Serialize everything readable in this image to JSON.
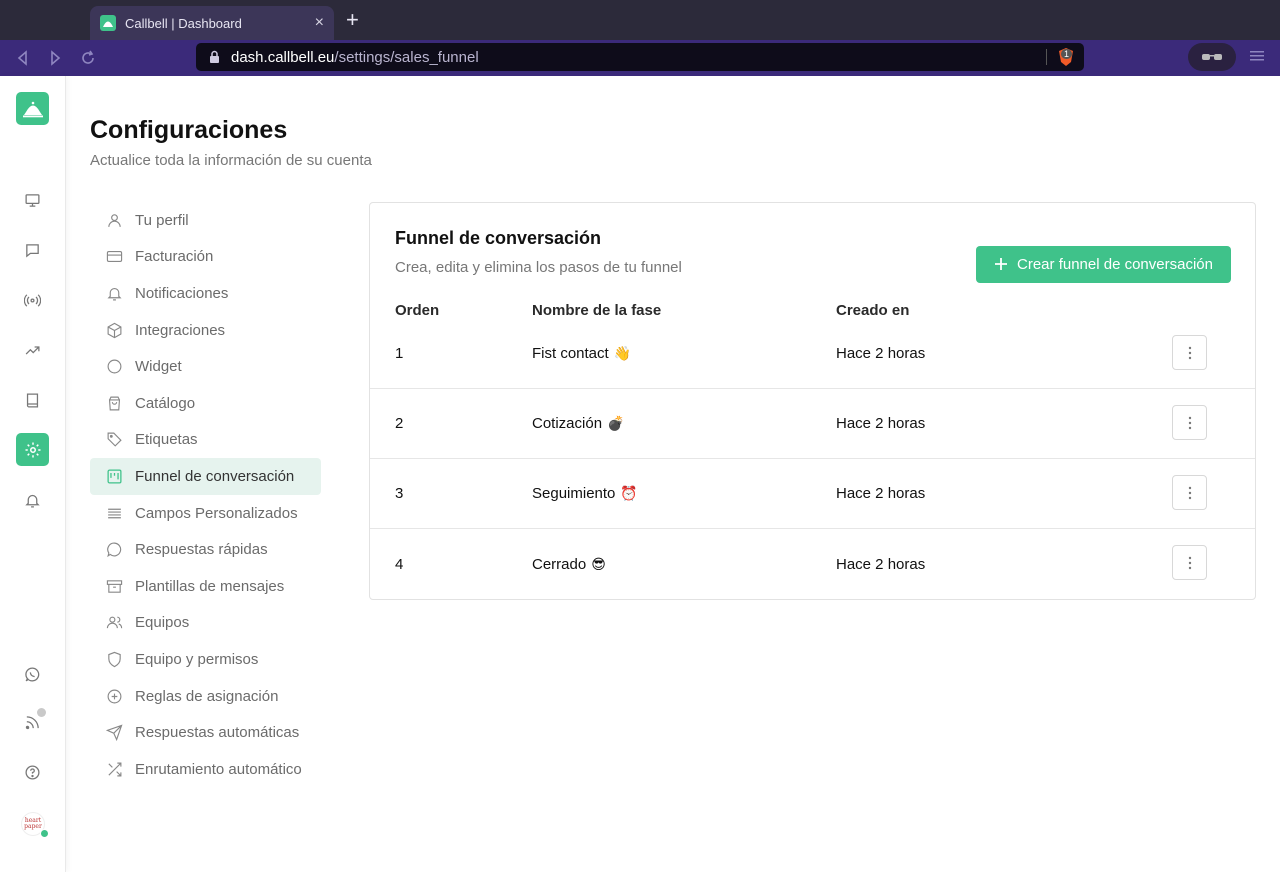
{
  "browser": {
    "tab_title": "Callbell | Dashboard",
    "tab_close": "×",
    "new_tab": "+",
    "url_host": "dash.callbell.eu",
    "url_path": "/settings/sales_funnel",
    "shield_count": "1"
  },
  "rail": {
    "icons": [
      "monitor-icon",
      "chat-icon",
      "broadcast-icon",
      "trending-icon",
      "book-icon",
      "settings-icon",
      "bell-icon",
      "whatsapp-icon",
      "rss-icon",
      "help-icon"
    ],
    "avatar_text": "heart paper"
  },
  "page": {
    "title": "Configuraciones",
    "subtitle": "Actualice toda la información de su cuenta"
  },
  "menu": {
    "items": [
      {
        "label": "Tu perfil",
        "icon": "user-icon"
      },
      {
        "label": "Facturación",
        "icon": "credit-card-icon"
      },
      {
        "label": "Notificaciones",
        "icon": "bell-icon"
      },
      {
        "label": "Integraciones",
        "icon": "cube-icon"
      },
      {
        "label": "Widget",
        "icon": "circle-icon"
      },
      {
        "label": "Catálogo",
        "icon": "shopping-bag-icon"
      },
      {
        "label": "Etiquetas",
        "icon": "tag-icon"
      },
      {
        "label": "Funnel de conversación",
        "icon": "funnel-board-icon"
      },
      {
        "label": "Campos Personalizados",
        "icon": "lines-icon"
      },
      {
        "label": "Respuestas rápidas",
        "icon": "message-circle-icon"
      },
      {
        "label": "Plantillas de mensajes",
        "icon": "archive-icon"
      },
      {
        "label": "Equipos",
        "icon": "users-icon"
      },
      {
        "label": "Equipo y permisos",
        "icon": "shield-icon"
      },
      {
        "label": "Reglas de asignación",
        "icon": "plus-circle-icon"
      },
      {
        "label": "Respuestas automáticas",
        "icon": "send-icon"
      },
      {
        "label": "Enrutamiento automático",
        "icon": "shuffle-icon"
      }
    ],
    "active_index": 7
  },
  "funnel": {
    "title": "Funnel de conversación",
    "subtitle": "Crea, edita y elimina los pasos de tu funnel",
    "create_button": "Crear funnel de conversación",
    "create_button_icon": "plus-icon",
    "columns": {
      "order": "Orden",
      "name": "Nombre de la fase",
      "created": "Creado en"
    },
    "rows": [
      {
        "order": "1",
        "name": "Fist contact",
        "emoji": "👋",
        "created": "Hace 2 horas"
      },
      {
        "order": "2",
        "name": "Cotización",
        "emoji": "💣",
        "created": "Hace 2 horas"
      },
      {
        "order": "3",
        "name": "Seguimiento",
        "emoji": "⏰",
        "created": "Hace 2 horas"
      },
      {
        "order": "4",
        "name": "Cerrado",
        "emoji": "😎",
        "created": "Hace 2 horas"
      }
    ]
  },
  "colors": {
    "brand": "#3fc28a",
    "active_menu_bg": "#e6f3ee",
    "browser_nav": "#3b2a7a",
    "browser_tabbar": "#2c2a3a"
  }
}
